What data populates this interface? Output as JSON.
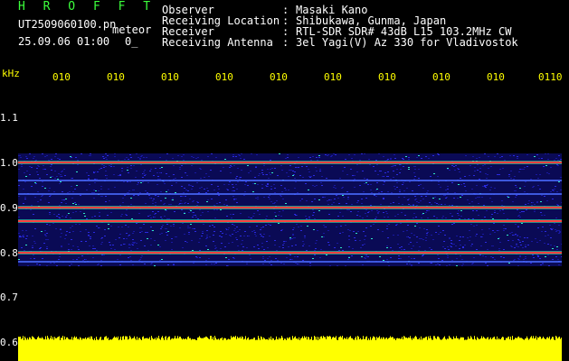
{
  "header": {
    "brand": "H R O F F T",
    "filename": "UT2509060100.pn",
    "mode": "meteor",
    "datetime": "25.09.06 01:00",
    "tag": "0_"
  },
  "info": [
    {
      "label": "Observer",
      "value": "Masaki Kano"
    },
    {
      "label": "Receiving Location",
      "value": "Shibukawa, Gunma, Japan"
    },
    {
      "label": "Receiver",
      "value": "RTL-SDR SDR# 43dB L15 103.2MHz CW"
    },
    {
      "label": "Receiving Antenna",
      "value": "3el Yagi(V) Az 330 for Vladivostok"
    }
  ],
  "separator": ":",
  "chart_data": {
    "type": "heatmap",
    "ylabel": "kHz",
    "y_ticks": [
      "1.1",
      "1.0",
      "0.9",
      "0.8",
      "0.7",
      "0.6"
    ],
    "x_ticks": [
      "010",
      "010",
      "010",
      "010",
      "010",
      "010",
      "010",
      "010",
      "010",
      "0110"
    ],
    "ylim": [
      0.58,
      1.15
    ],
    "band_range": [
      0.77,
      1.02
    ],
    "strong_lines_khz": [
      1.0,
      0.9,
      0.87,
      0.8
    ],
    "weak_lines_khz": [
      0.96,
      0.93,
      0.78
    ],
    "colors": {
      "background": "#000000",
      "noise": "#2a2adf",
      "bright": "#30e8c8",
      "line": "#ff4040",
      "amplitude": "#ffff00"
    }
  }
}
